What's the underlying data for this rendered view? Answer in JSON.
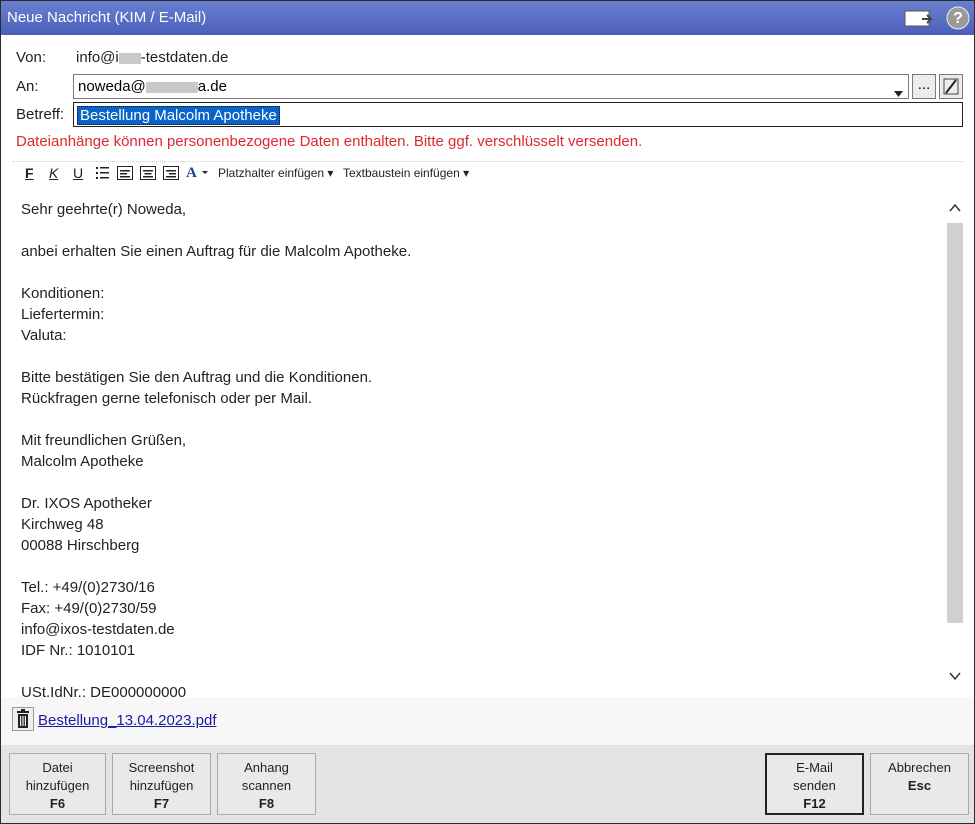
{
  "window": {
    "title": "Neue Nachricht (KIM / E-Mail)",
    "icons": [
      "window-toggle-icon",
      "help-icon"
    ]
  },
  "form": {
    "from_label": "Von:",
    "from_value_prefix": "info@i",
    "from_value_suffix": "-testdaten.de",
    "to_label": "An:",
    "to_value_prefix": "noweda@",
    "to_value_suffix": "a.de",
    "to_browse_label": "...",
    "subject_label": "Betreff:",
    "subject_value": "Bestellung Malcolm Apotheke"
  },
  "warning": "Dateianhänge können personenbezogene Daten enthalten. Bitte ggf. verschlüsselt versenden.",
  "toolbar": {
    "bold": "F",
    "italic": "K",
    "underline": "U",
    "placeholder_label": "Platzhalter einfügen",
    "textblock_label": "Textbaustein einfügen"
  },
  "body_lines": [
    "Sehr geehrte(r) Noweda,",
    "",
    "anbei erhalten Sie einen Auftrag für die Malcolm Apotheke.",
    "",
    "Konditionen:",
    "Liefertermin:",
    "Valuta:",
    "",
    "Bitte bestätigen Sie den Auftrag und die Konditionen.",
    "Rückfragen gerne telefonisch oder per Mail.",
    "",
    "Mit freundlichen Grüßen,",
    "Malcolm Apotheke",
    "",
    "Dr. IXOS Apotheker",
    "Kirchweg 48",
    "00088 Hirschberg",
    "",
    "Tel.: +49/(0)2730/16",
    "Fax: +49/(0)2730/59",
    "info@ixos-testdaten.de",
    "IDF Nr.: 1010101",
    "",
    "USt.IdNr.: DE000000000"
  ],
  "attachment": {
    "name": "Bestellung_13.04.2023.pdf"
  },
  "buttons": [
    {
      "line1": "Datei",
      "line2": "hinzufügen",
      "key": "F6"
    },
    {
      "line1": "Screenshot",
      "line2": "hinzufügen",
      "key": "F7"
    },
    {
      "line1": "Anhang",
      "line2": "scannen",
      "key": "F8"
    },
    {
      "line1": "E-Mail",
      "line2": "senden",
      "key": "F12"
    },
    {
      "line1": "Abbrechen",
      "line2": "",
      "key": "Esc"
    }
  ]
}
